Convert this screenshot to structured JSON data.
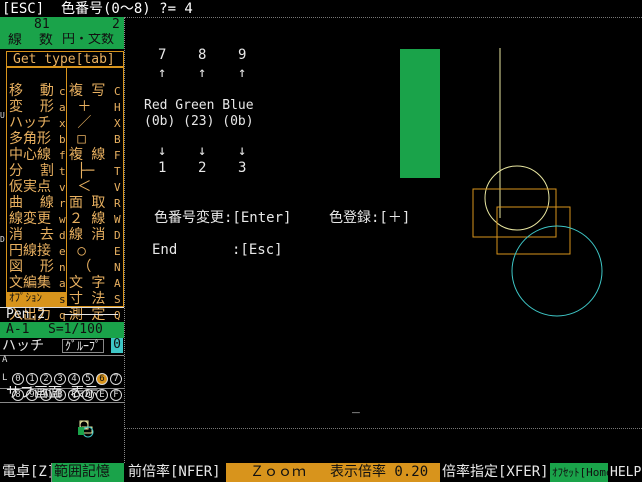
{
  "prompt": "[ESC]  色番号(0～8) ?= 4",
  "left_panel": {
    "line_count": "81",
    "arc_count": "2",
    "line_label": "線  数",
    "arc_label": "円・文数",
    "get_type": "Get type[tab]",
    "menu_left": [
      {
        "label": "移  動",
        "key": "c"
      },
      {
        "label": "変  形",
        "key": "a"
      },
      {
        "label": "ハッチ",
        "key": "x"
      },
      {
        "label": "多角形",
        "key": "b"
      },
      {
        "label": "中心線",
        "key": "f"
      },
      {
        "label": "分  割",
        "key": "t"
      },
      {
        "label": "仮実点",
        "key": "v"
      },
      {
        "label": "曲  線",
        "key": "r"
      },
      {
        "label": "線変更",
        "key": "w"
      },
      {
        "label": "消  去",
        "key": "d"
      },
      {
        "label": "円線接",
        "key": "e"
      },
      {
        "label": "図  形",
        "key": "n"
      },
      {
        "label": "文編集",
        "key": "a"
      },
      {
        "label": "ｵﾌﾟｼｮﾝ",
        "key": "s"
      },
      {
        "label": "入出力",
        "key": "q"
      }
    ],
    "menu_right": [
      {
        "label": "複 写",
        "key": "C"
      },
      {
        "label": " ＋",
        "key": "H"
      },
      {
        "label": " ／",
        "key": "X"
      },
      {
        "label": " □",
        "key": "B"
      },
      {
        "label": "複 線",
        "key": "F"
      },
      {
        "label": " ├─",
        "key": "T"
      },
      {
        "label": " ＜",
        "key": "V"
      },
      {
        "label": "面 取",
        "key": "R"
      },
      {
        "label": "２ 線",
        "key": "W"
      },
      {
        "label": "線 消",
        "key": "D"
      },
      {
        "label": " ○",
        "key": "E"
      },
      {
        "label": " （",
        "key": "N"
      },
      {
        "label": "文 字",
        "key": "A"
      },
      {
        "label": "寸 法",
        "key": "S"
      },
      {
        "label": "測 定",
        "key": "Q"
      }
    ],
    "pen": "Pen.2",
    "sheet": "A-1",
    "scale": "S=1/100",
    "hatch": "ハッチ",
    "group": "ｸﾞﾙｰﾌﾟ",
    "group_num": "0",
    "layer_row1": [
      "0",
      "1",
      "2",
      "3",
      "4",
      "5",
      "6",
      "7"
    ],
    "layer_row2": [
      "8",
      "9",
      "A",
      "B",
      "C",
      "D",
      "E",
      "F"
    ],
    "side_marks": [
      "A",
      "L"
    ],
    "sub_screen": "サブ画面 表示",
    "side_letters": [
      "U",
      "D"
    ]
  },
  "canvas": {
    "digits": [
      "7",
      "8",
      "9"
    ],
    "arrows_up": [
      "↑",
      "↑",
      "↑"
    ],
    "rgb_label": "Red Green Blue",
    "rgb_values": "(0b) (23) (0b)",
    "arrows_down": [
      "↓",
      "↓",
      "↓"
    ],
    "digits_bottom": [
      "1",
      "2",
      "3"
    ],
    "color_change": "色番号変更:[Enter]",
    "color_register": "色登録:[＋]",
    "end_label": "End",
    "end_key": ":[Esc]",
    "cursor": "_"
  },
  "status_bar": {
    "b1": "電卓[Z]",
    "b2": "範囲記憶",
    "b3": "前倍率[NFER]",
    "b4": "Ｚｏｏｍ",
    "b5": "表示倍率 0.20",
    "b6": "倍率指定[XFER]",
    "b7": "ｵﾌｾｯﾄ[Home]",
    "b8": "HELP"
  },
  "colors": {
    "green": "#1aa34a",
    "orange": "#d8941c",
    "cyan": "#3ec6c6",
    "yellow": "#e8e6a0"
  }
}
